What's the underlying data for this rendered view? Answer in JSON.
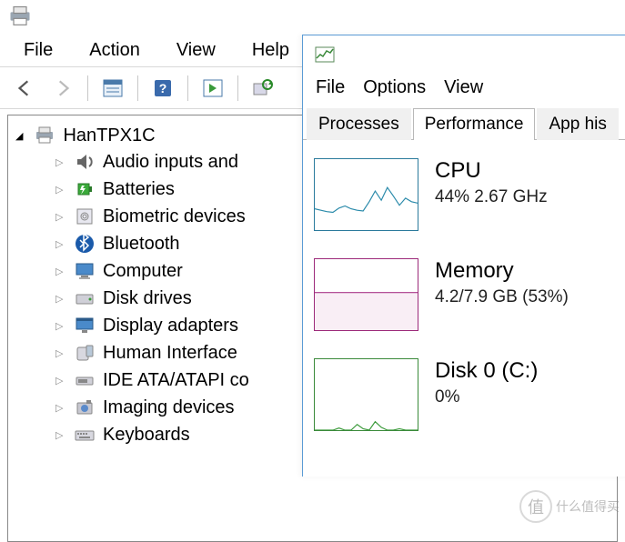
{
  "devmgr": {
    "menu": {
      "file": "File",
      "action": "Action",
      "view": "View",
      "help": "Help"
    },
    "root": "HanTPX1C",
    "items": [
      {
        "label": "Audio inputs and",
        "icon": "speaker"
      },
      {
        "label": "Batteries",
        "icon": "battery"
      },
      {
        "label": "Biometric devices",
        "icon": "fingerprint"
      },
      {
        "label": "Bluetooth",
        "icon": "bluetooth"
      },
      {
        "label": "Computer",
        "icon": "computer"
      },
      {
        "label": "Disk drives",
        "icon": "disk"
      },
      {
        "label": "Display adapters",
        "icon": "display"
      },
      {
        "label": "Human Interface",
        "icon": "hid"
      },
      {
        "label": "IDE ATA/ATAPI co",
        "icon": "ide"
      },
      {
        "label": "Imaging devices",
        "icon": "camera"
      },
      {
        "label": "Keyboards",
        "icon": "keyboard"
      }
    ]
  },
  "taskmgr": {
    "menu": {
      "file": "File",
      "options": "Options",
      "view": "View"
    },
    "tabs": {
      "processes": "Processes",
      "performance": "Performance",
      "apphist": "App his"
    },
    "perf": {
      "cpu": {
        "title": "CPU",
        "sub": "44% 2.67 GHz"
      },
      "mem": {
        "title": "Memory",
        "sub": "4.2/7.9 GB (53%)"
      },
      "disk": {
        "title": "Disk 0 (C:)",
        "sub": "0%"
      }
    }
  },
  "chart_data": [
    {
      "type": "line",
      "title": "CPU",
      "ylim": [
        0,
        100
      ],
      "values": [
        30,
        28,
        26,
        25,
        31,
        34,
        30,
        28,
        27,
        40,
        55,
        42,
        60,
        48,
        35,
        45,
        40,
        38
      ]
    },
    {
      "type": "area",
      "title": "Memory",
      "ylim": [
        0,
        100
      ],
      "values": [
        53,
        53,
        53,
        53,
        53,
        53,
        53,
        53,
        53,
        53,
        53,
        53,
        53,
        53,
        53,
        53,
        53,
        53
      ]
    },
    {
      "type": "line",
      "title": "Disk 0 (C:)",
      "ylim": [
        0,
        100
      ],
      "values": [
        0,
        0,
        0,
        0,
        3,
        0,
        0,
        8,
        2,
        0,
        12,
        4,
        0,
        0,
        2,
        0,
        0,
        0
      ]
    }
  ],
  "watermark": "什么值得买"
}
